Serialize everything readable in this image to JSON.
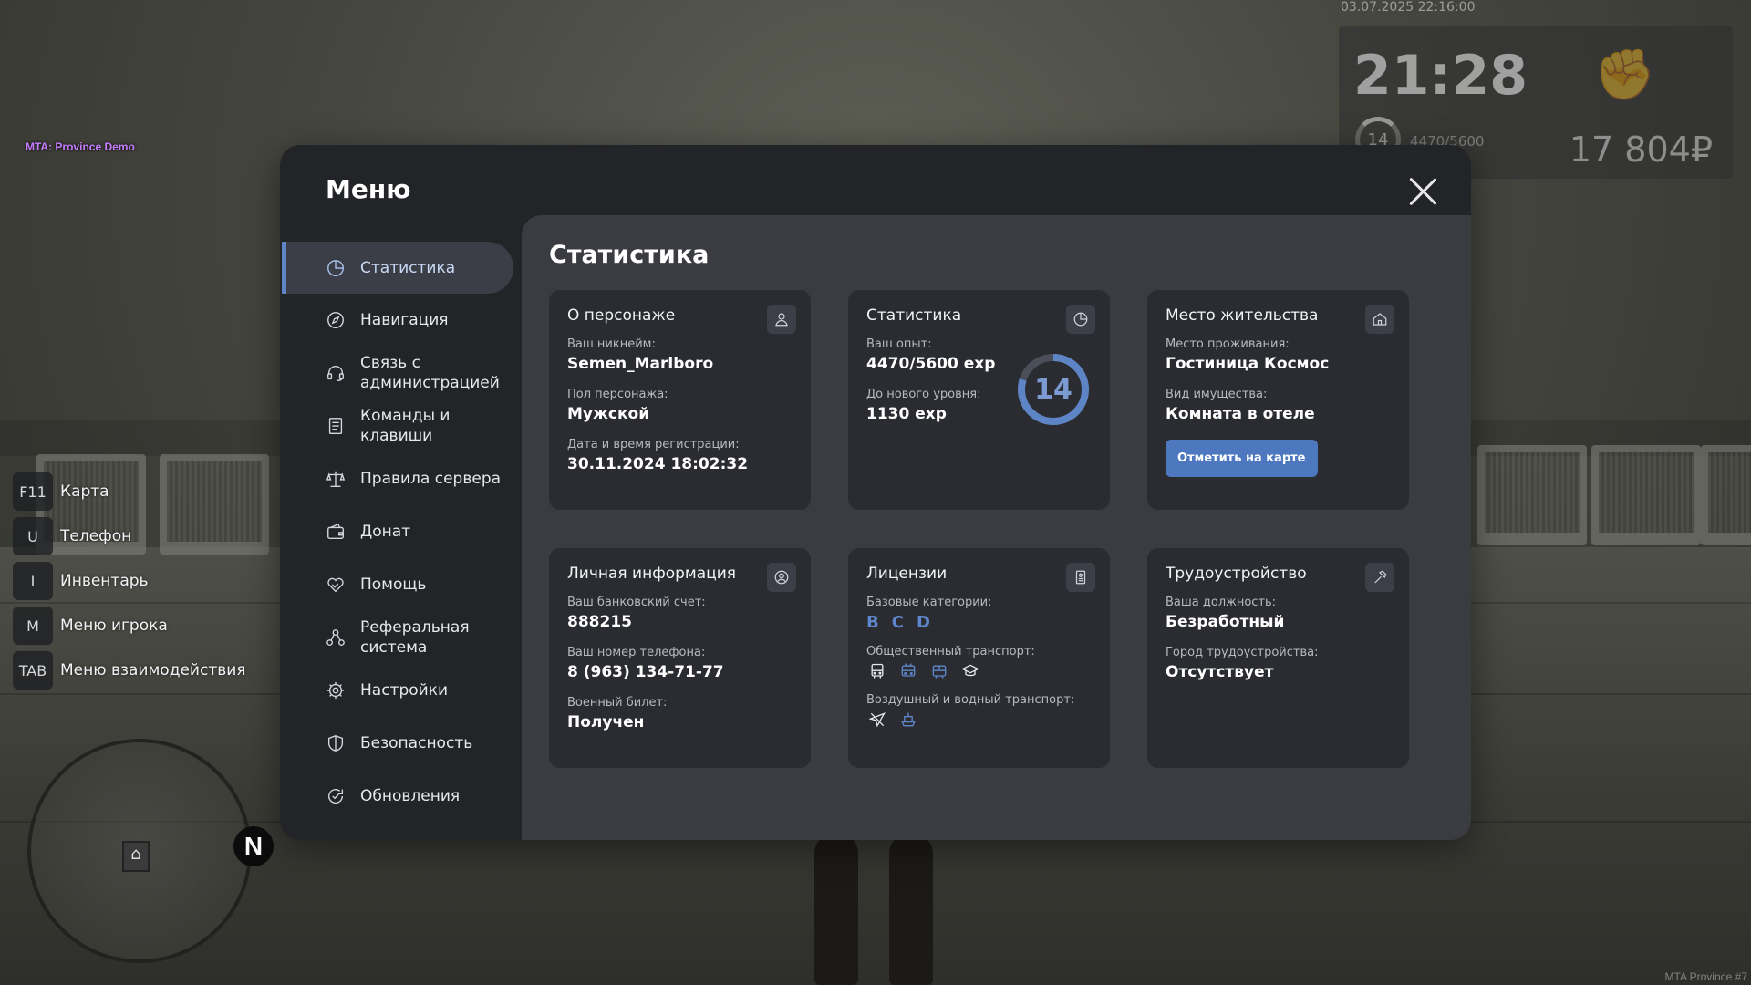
{
  "overlay": {
    "server_tag": "MTA: Province Demo",
    "datetime": "03.07.2025 22:16:00",
    "watermark": "MTA Province #7"
  },
  "hud": {
    "time": "21:28",
    "level": "14",
    "exp": "4470/5600",
    "money": "17 804₽",
    "fist_icon": "fist-icon"
  },
  "hotkeys": [
    {
      "key": "F11",
      "label": "Карта"
    },
    {
      "key": "U",
      "label": "Телефон"
    },
    {
      "key": "I",
      "label": "Инвентарь"
    },
    {
      "key": "M",
      "label": "Меню игрока"
    },
    {
      "key": "TAB",
      "label": "Меню взаимодействия"
    }
  ],
  "minimap": {
    "north": "N"
  },
  "menu": {
    "title": "Меню",
    "nav": [
      {
        "label": "Статистика",
        "icon": "pie-chart-icon",
        "active": true
      },
      {
        "label": "Навигация",
        "icon": "compass-icon"
      },
      {
        "label": "Связь с администрацией",
        "icon": "headset-icon"
      },
      {
        "label": "Команды и клавиши",
        "icon": "document-icon"
      },
      {
        "label": "Правила сервера",
        "icon": "scales-icon"
      },
      {
        "label": "Донат",
        "icon": "wallet-icon"
      },
      {
        "label": "Помощь",
        "icon": "handshake-icon"
      },
      {
        "label": "Реферальная система",
        "icon": "referral-icon"
      },
      {
        "label": "Настройки",
        "icon": "gear-icon"
      },
      {
        "label": "Безопасность",
        "icon": "shield-icon"
      },
      {
        "label": "Обновления",
        "icon": "refresh-icon"
      }
    ]
  },
  "content": {
    "title": "Статистика",
    "character": {
      "title": "О персонаже",
      "nickname_label": "Ваш никнейм:",
      "nickname": "Semen_Marlboro",
      "gender_label": "Пол персонажа:",
      "gender": "Мужской",
      "reg_label": "Дата и время регистрации:",
      "reg": "30.11.2024 18:02:32"
    },
    "stats": {
      "title": "Статистика",
      "exp_label": "Ваш опыт:",
      "exp": "4470/5600 exp",
      "next_label": "До нового уровня:",
      "next": "1130 exp",
      "level": "14",
      "progress": 0.798
    },
    "residence": {
      "title": "Место жительства",
      "place_label": "Место проживания:",
      "place": "Гостиница Космос",
      "type_label": "Вид имущества:",
      "type": "Комната в отеле",
      "button": "Отметить на карте"
    },
    "personal": {
      "title": "Личная информация",
      "bank_label": "Ваш банковский счет:",
      "bank": "888215",
      "phone_label": "Ваш номер телефона:",
      "phone": "8 (963) 134-71-77",
      "military_label": "Военный билет:",
      "military": "Получен"
    },
    "licenses": {
      "title": "Лицензии",
      "base_label": "Базовые категории:",
      "categories": [
        "B",
        "C",
        "D"
      ],
      "public_label": "Общественный транспорт:",
      "air_label": "Воздушный и водный транспорт:"
    },
    "employment": {
      "title": "Трудоустройство",
      "position_label": "Ваша должность:",
      "position": "Безработный",
      "city_label": "Город трудоустройства:",
      "city": "Отсутствует"
    }
  },
  "colors": {
    "accent": "#5d85c6",
    "button": "#4d78bf",
    "panel": "#232428",
    "content": "#3a3c42",
    "card": "#2a2c31"
  }
}
